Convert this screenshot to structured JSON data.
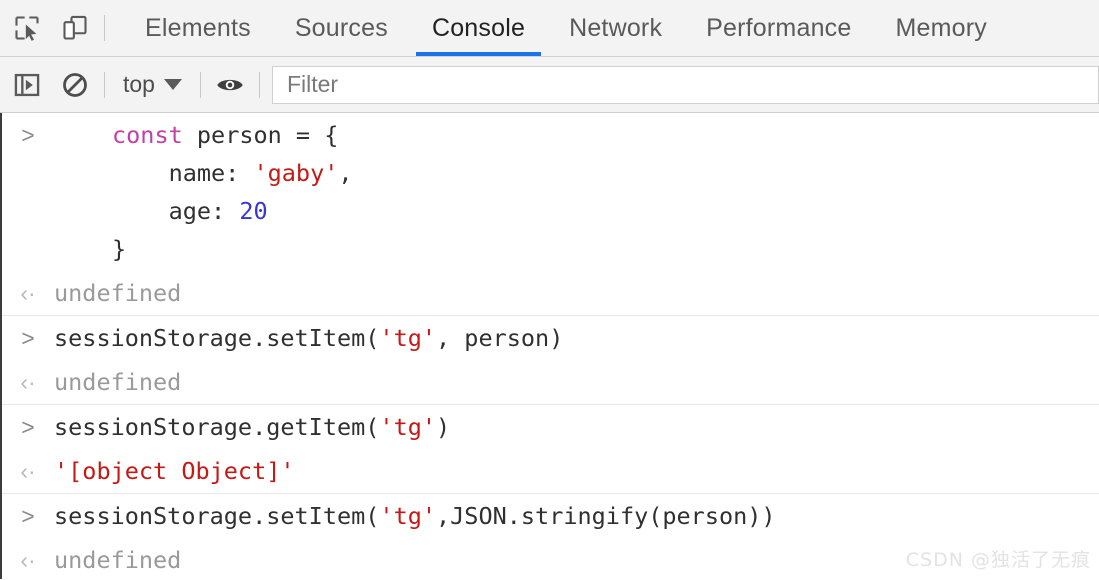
{
  "devtools": {
    "left_icons": [
      {
        "name": "inspect-element-icon",
        "title": "Inspect element"
      },
      {
        "name": "device-toolbar-icon",
        "title": "Toggle device toolbar"
      }
    ],
    "tabs": [
      {
        "label": "Elements",
        "active": false
      },
      {
        "label": "Sources",
        "active": false
      },
      {
        "label": "Console",
        "active": true
      },
      {
        "label": "Network",
        "active": false
      },
      {
        "label": "Performance",
        "active": false
      },
      {
        "label": "Memory",
        "active": false
      }
    ],
    "active_tab": "Console",
    "accent_color": "#1a73e8"
  },
  "toolbar": {
    "sidebar_toggle_icon": "show-console-sidebar-icon",
    "clear_console_icon": "clear-console-icon",
    "context_label": "top",
    "context_caret_icon": "chevron-down-icon",
    "eye_icon": "live-expression-eye-icon",
    "filter": {
      "value": "",
      "placeholder": "Filter"
    }
  },
  "console": {
    "input_prompt_glyph": ">",
    "output_prompt_glyph": "‹·",
    "groups": [
      {
        "input_lines": [
          [
            {
              "t": "const",
              "c": "kw"
            },
            {
              "t": " person = {",
              "c": "pln"
            }
          ],
          [
            {
              "t": "    name: ",
              "c": "pln"
            },
            {
              "t": "'gaby'",
              "c": "str"
            },
            {
              "t": ",",
              "c": "pln"
            }
          ],
          [
            {
              "t": "    age: ",
              "c": "pln"
            },
            {
              "t": "20",
              "c": "num"
            }
          ],
          [
            {
              "t": "}",
              "c": "pln"
            }
          ]
        ],
        "input_indent": true,
        "output": {
          "text": "undefined",
          "kind": "undef"
        }
      },
      {
        "input_lines": [
          [
            {
              "t": "sessionStorage.setItem(",
              "c": "pln"
            },
            {
              "t": "'tg'",
              "c": "str"
            },
            {
              "t": ", person)",
              "c": "pln"
            }
          ]
        ],
        "input_indent": false,
        "output": {
          "text": "undefined",
          "kind": "undef"
        }
      },
      {
        "input_lines": [
          [
            {
              "t": "sessionStorage.getItem(",
              "c": "pln"
            },
            {
              "t": "'tg'",
              "c": "str"
            },
            {
              "t": ")",
              "c": "pln"
            }
          ]
        ],
        "input_indent": false,
        "output": {
          "text": "'[object Object]'",
          "kind": "str"
        }
      },
      {
        "input_lines": [
          [
            {
              "t": "sessionStorage.setItem(",
              "c": "pln"
            },
            {
              "t": "'tg'",
              "c": "str"
            },
            {
              "t": ",JSON.stringify(person))",
              "c": "pln"
            }
          ]
        ],
        "input_indent": false,
        "output": {
          "text": "undefined",
          "kind": "undef"
        }
      }
    ]
  },
  "watermark": {
    "text": "CSDN @独活了无痕"
  }
}
